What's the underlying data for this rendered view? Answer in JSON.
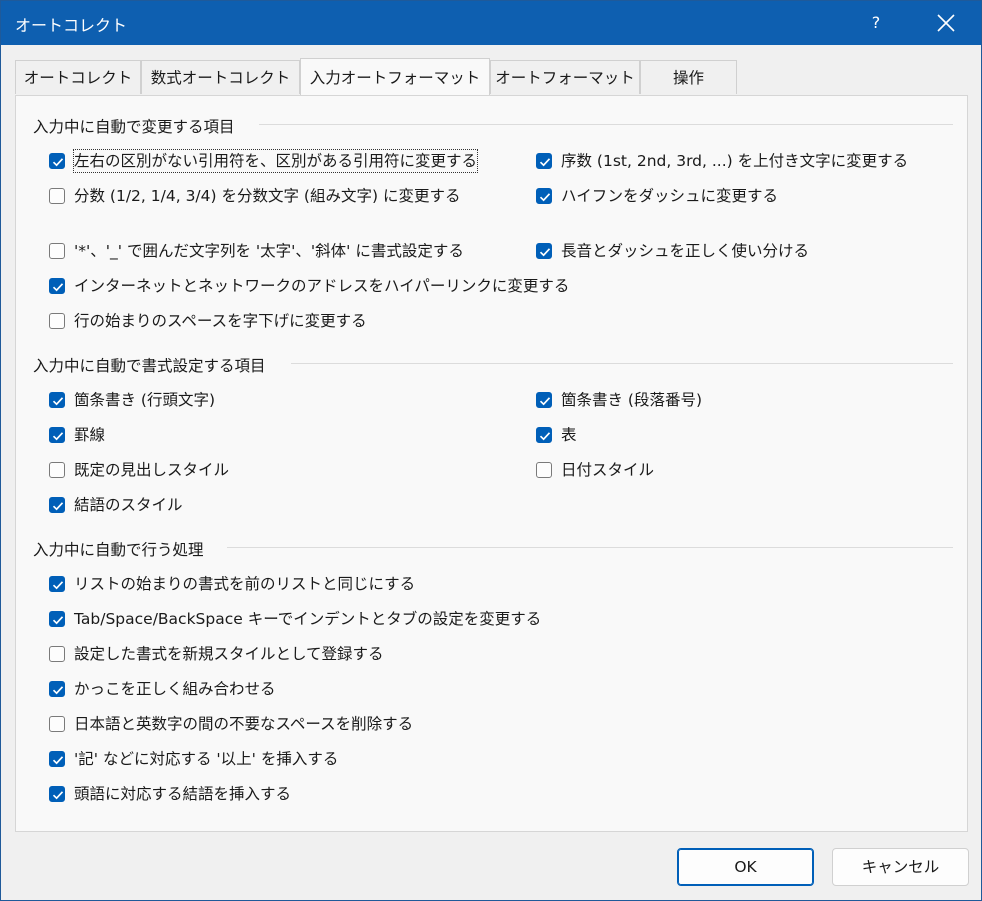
{
  "window": {
    "title": "オートコレクト",
    "help_label": "?"
  },
  "tabs": [
    {
      "label": "オートコレクト",
      "active": false
    },
    {
      "label": "数式オートコレクト",
      "active": false
    },
    {
      "label": "入力オートフォーマット",
      "active": true
    },
    {
      "label": "オートフォーマット",
      "active": false
    },
    {
      "label": "操作",
      "active": false
    }
  ],
  "groups": [
    {
      "title": "入力中に自動で変更する項目",
      "options": [
        {
          "label": "左右の区別がない引用符を、区別がある引用符に変更する",
          "checked": true
        },
        {
          "label": "序数 (1st, 2nd, 3rd, ...) を上付き文字に変更する",
          "checked": true
        },
        {
          "label": "分数 (1/2, 1/4, 3/4) を分数文字 (組み文字) に変更する",
          "checked": false
        },
        {
          "label": "ハイフンをダッシュに変更する",
          "checked": true
        },
        {
          "label": "'*'、'_' で囲んだ文字列を '太字'、'斜体' に書式設定する",
          "checked": false
        },
        {
          "label": "長音とダッシュを正しく使い分ける",
          "checked": true
        },
        {
          "label": "インターネットとネットワークのアドレスをハイパーリンクに変更する",
          "checked": true
        },
        {
          "label": "行の始まりのスペースを字下げに変更する",
          "checked": false
        }
      ]
    },
    {
      "title": "入力中に自動で書式設定する項目",
      "options": [
        {
          "label": "箇条書き (行頭文字)",
          "checked": true
        },
        {
          "label": "箇条書き (段落番号)",
          "checked": true
        },
        {
          "label": "罫線",
          "checked": true
        },
        {
          "label": "表",
          "checked": true
        },
        {
          "label": "既定の見出しスタイル",
          "checked": false
        },
        {
          "label": "日付スタイル",
          "checked": false
        },
        {
          "label": "結語のスタイル",
          "checked": true
        }
      ]
    },
    {
      "title": "入力中に自動で行う処理",
      "options": [
        {
          "label": "リストの始まりの書式を前のリストと同じにする",
          "checked": true
        },
        {
          "label": "Tab/Space/BackSpace キーでインデントとタブの設定を変更する",
          "checked": true
        },
        {
          "label": "設定した書式を新規スタイルとして登録する",
          "checked": false
        },
        {
          "label": "かっこを正しく組み合わせる",
          "checked": true
        },
        {
          "label": "日本語と英数字の間の不要なスペースを削除する",
          "checked": false
        },
        {
          "label": "'記' などに対応する '以上' を挿入する",
          "checked": true
        },
        {
          "label": "頭語に対応する結語を挿入する",
          "checked": true
        }
      ]
    }
  ],
  "buttons": {
    "ok": "OK",
    "cancel": "キャンセル"
  },
  "colors": {
    "titlebar": "#0e5fb0",
    "accent": "#005fb8"
  }
}
